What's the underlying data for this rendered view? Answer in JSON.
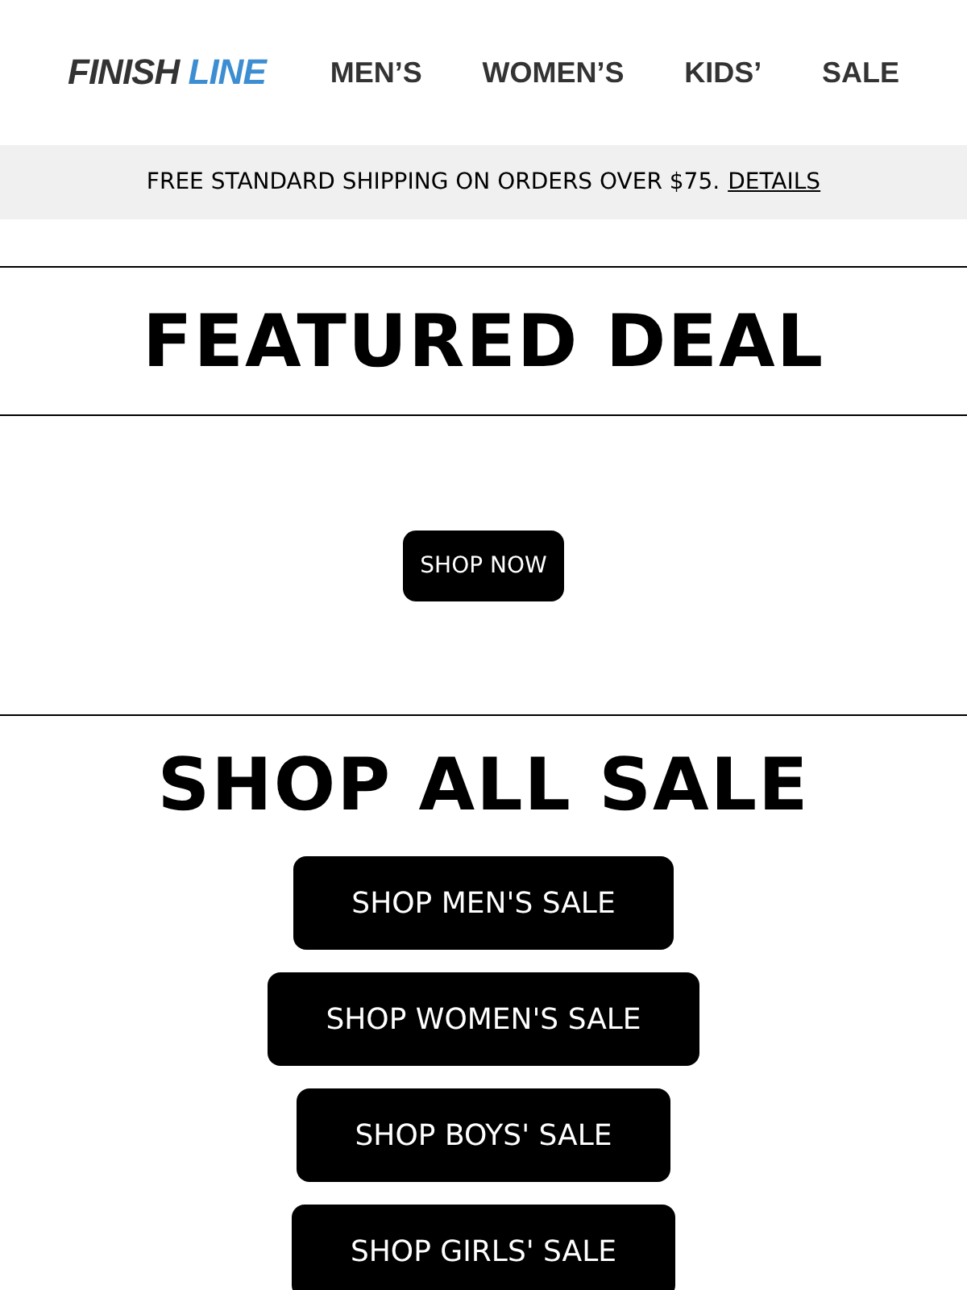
{
  "header": {
    "logo": [
      {
        "text": "FINISH",
        "color": "#333333"
      },
      {
        "text": "LINE",
        "color": "#3d8dd2"
      }
    ],
    "nav": [
      {
        "label": "MEN’S"
      },
      {
        "label": "WOMEN’S"
      },
      {
        "label": "KIDS’"
      },
      {
        "label": "SALE"
      }
    ]
  },
  "promo_bar": {
    "text": "FREE STANDARD SHIPPING ON ORDERS OVER $75.",
    "link": "DETAILS"
  },
  "featured": {
    "title": "FEATURED DEAL",
    "button": "SHOP NOW"
  },
  "sale": {
    "title": "SHOP ALL SALE",
    "buttons": [
      {
        "label": "SHOP MEN'S SALE"
      },
      {
        "label": "SHOP WOMEN'S SALE"
      },
      {
        "label": "SHOP BOYS' SALE"
      },
      {
        "label": "SHOP GIRLS' SALE"
      }
    ]
  }
}
